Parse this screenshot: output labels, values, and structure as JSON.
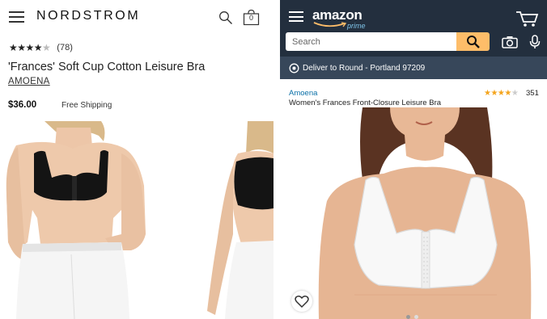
{
  "nordstrom": {
    "logo": "NORDSTROM",
    "bag_count": "0",
    "rating": {
      "stars_filled": 4,
      "stars_total": 5,
      "count": "(78)"
    },
    "product_title": "'Frances' Soft Cup Cotton Leisure Bra",
    "brand": "AMOENA",
    "price": "$36.00",
    "shipping": "Free Shipping",
    "icons": [
      "menu-icon",
      "search-icon",
      "shopping-bag-icon"
    ]
  },
  "amazon": {
    "logo": "amazon",
    "logo_sub": "prime",
    "search": {
      "placeholder": "Search",
      "value": ""
    },
    "deliver_text": "Deliver to Round - Portland 97209",
    "product_brand": "Amoena",
    "product_title": "Women's Frances Front-Closure Leisure Bra",
    "rating": {
      "stars_filled": 4,
      "stars_total": 5,
      "count": "351"
    },
    "image_count": 2,
    "image_selected": 1,
    "icons": [
      "menu-icon",
      "cart-icon",
      "search-icon",
      "camera-icon",
      "microphone-icon",
      "location-pin-icon",
      "heart-icon"
    ]
  },
  "colors": {
    "amazon_header": "#232f3e",
    "amazon_deliver_bar": "#37475a",
    "amazon_search_button": "#febd69",
    "amazon_prime_accent": "#7fc4e8",
    "amazon_link": "#0a70a8",
    "amazon_stars": "#f4a41c"
  }
}
